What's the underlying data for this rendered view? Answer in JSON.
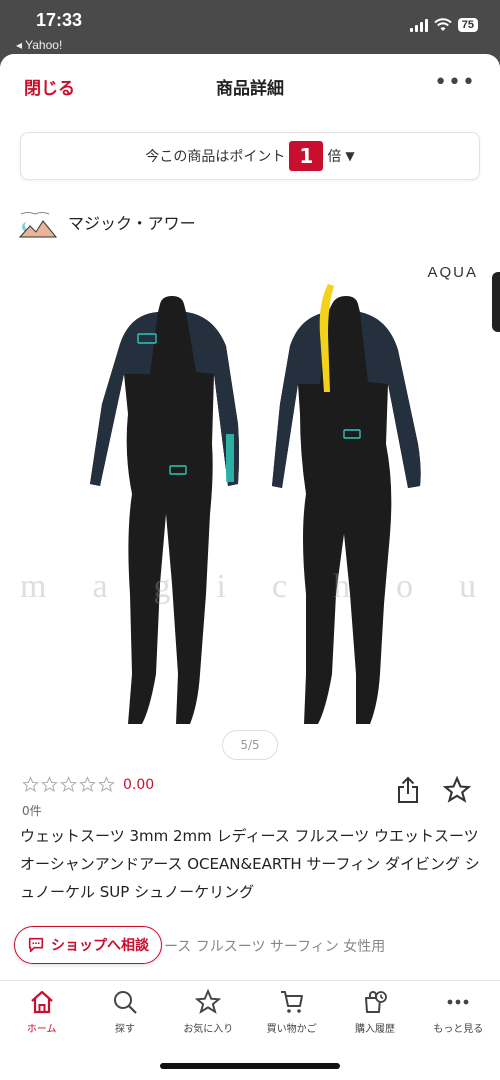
{
  "status_bar": {
    "time": "17:33",
    "back_app": "◂ Yahoo!",
    "battery": "75"
  },
  "header": {
    "close_label": "閉じる",
    "title": "商品詳細",
    "more_label": "•••"
  },
  "points": {
    "prefix": "今この商品はポイント",
    "multiplier": "1",
    "suffix": "倍"
  },
  "shop": {
    "name": "マジック・アワー"
  },
  "product_image": {
    "brand_tag": "AQUA",
    "watermark": "magichour"
  },
  "pager": {
    "text": "5/5"
  },
  "rating": {
    "stars_filled": 0,
    "value": "0.00",
    "review_count": "0件"
  },
  "product": {
    "title": "ウェットスーツ 3mm 2mm レディース フルスーツ ウエットスーツ オーシャンアンドアース OCEAN&EARTH サーフィン ダイビング シュノーケル SUP シュノーケリング",
    "subtitle_partial": "ィース フルスーツ サーフィン 女性用"
  },
  "consult": {
    "label": "ショップへ相談"
  },
  "tabbar": {
    "tabs": [
      {
        "label": "ホーム"
      },
      {
        "label": "探す"
      },
      {
        "label": "お気に入り"
      },
      {
        "label": "買い物かご"
      },
      {
        "label": "購入履歴"
      },
      {
        "label": "もっと見る"
      }
    ]
  },
  "colors": {
    "accent": "#c8102e",
    "suit_body": "#1c1c1c",
    "suit_sleeve": "#24303d",
    "zip_yellow": "#f2d21b",
    "logo_teal": "#2fc6b8"
  }
}
